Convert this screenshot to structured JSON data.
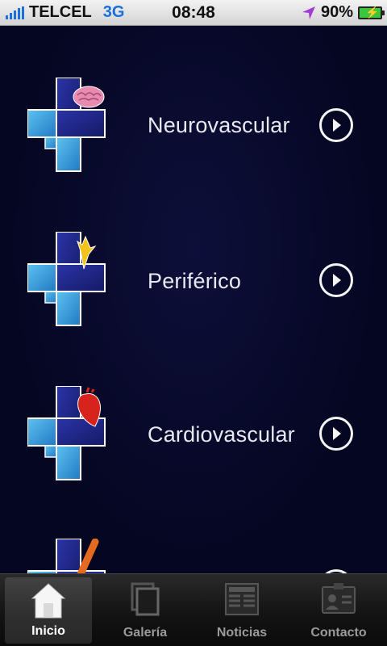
{
  "status_bar": {
    "carrier": "TELCEL",
    "network": "3G",
    "time": "08:48",
    "battery": "90%"
  },
  "menu": {
    "items": [
      {
        "label": "Neurovascular",
        "icon": "brain-icon"
      },
      {
        "label": "Periférico",
        "icon": "peripheral-icon"
      },
      {
        "label": "Cardiovascular",
        "icon": "heart-icon"
      },
      {
        "label": "",
        "icon": "partial-icon"
      }
    ]
  },
  "tabs": [
    {
      "label": "Inicio",
      "icon": "home-icon",
      "active": true
    },
    {
      "label": "Galería",
      "icon": "gallery-icon",
      "active": false
    },
    {
      "label": "Noticias",
      "icon": "news-icon",
      "active": false
    },
    {
      "label": "Contacto",
      "icon": "contact-card-icon",
      "active": false
    }
  ],
  "colors": {
    "background": "#060726",
    "cross_blue": "#3a9bd8",
    "cross_navy": "#1a2080",
    "accent_blue": "#1a6fd8"
  }
}
